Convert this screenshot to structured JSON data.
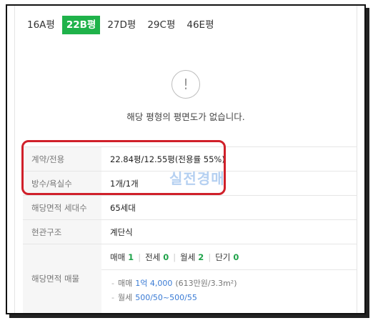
{
  "tabs": [
    {
      "label": "16A평",
      "active": false
    },
    {
      "label": "22B평",
      "active": true
    },
    {
      "label": "27D평",
      "active": false
    },
    {
      "label": "29C평",
      "active": false
    },
    {
      "label": "46E평",
      "active": false
    }
  ],
  "notice": {
    "icon_glyph": "!",
    "message": "해당 평형의 평면도가 없습니다."
  },
  "table": {
    "contract_area": {
      "label": "계약/전용",
      "value": "22.84평/12.55평(전용률 55%)"
    },
    "rooms": {
      "label": "방수/욕실수",
      "value": "1개/1개"
    },
    "households": {
      "label": "해당면적 세대수",
      "value": "65세대"
    },
    "entrance": {
      "label": "현관구조",
      "value": "계단식"
    },
    "listings": {
      "label": "해당면적 매물",
      "counts": [
        {
          "name": "매매",
          "count": "1"
        },
        {
          "name": "전세",
          "count": "0"
        },
        {
          "name": "월세",
          "count": "2"
        },
        {
          "name": "단기",
          "count": "0"
        }
      ],
      "items": [
        {
          "type": "매매",
          "price": "1억 4,000",
          "detail": "(613만원/3.3m²)"
        },
        {
          "type": "월세",
          "price": "500/50~500/55",
          "detail": ""
        }
      ]
    }
  },
  "watermark": "실전경매",
  "colors": {
    "accent_green": "#1fb24a",
    "highlight_red": "#d0202a",
    "price_blue": "#3a7bd5"
  }
}
